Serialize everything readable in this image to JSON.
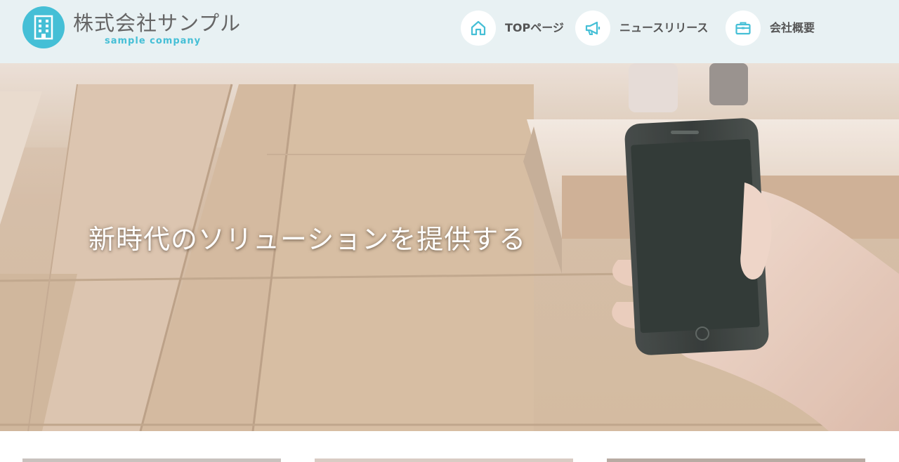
{
  "header": {
    "logo_name": "株式会社サンプル",
    "logo_sub": "sample company",
    "logo_icon": "building-icon"
  },
  "nav": {
    "items": [
      {
        "label": "TOPページ",
        "icon": "home-icon"
      },
      {
        "label": "ニュースリリース",
        "icon": "megaphone-icon"
      },
      {
        "label": "会社概要",
        "icon": "briefcase-icon"
      }
    ]
  },
  "hero": {
    "headline": "新時代のソリューションを提供する"
  },
  "colors": {
    "accent": "#45bfd6",
    "header_bg": "#e8f1f3",
    "text_gray": "#666666"
  }
}
